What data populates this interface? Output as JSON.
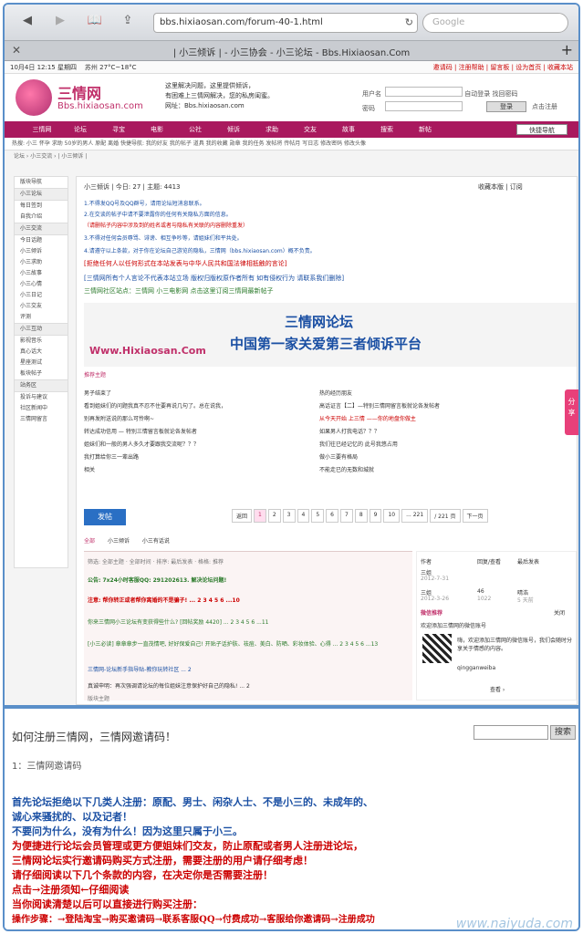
{
  "browser": {
    "url": "bbs.hixiaosan.com/forum-40-1.html",
    "search_placeholder": "Google",
    "tab_title": "| 小三倾诉 | - 小三协会 - 小三论坛 - Bbs.Hixiaosan.Com"
  },
  "topstrip": {
    "date": "10月4日 12:15 星期四",
    "weather": "苏州  27°C~18°C",
    "links": "邀请码 | 注册帮助 | 留言板 | 设为首页 | 收藏本站"
  },
  "header": {
    "logo_text": "三情网",
    "logo_url": "Bbs.hixiaosan.com",
    "slogan_1": "这里解决问题，这里提供倾诉，",
    "slogan_2": "有困难上三情网解决，您的私房闺蜜。",
    "slogan_3": "网址：Bbs.hixiaosan.com",
    "user_label": "用户名",
    "pass_label": "密码",
    "autologin": "自动登录",
    "find_pass": "找回密码",
    "login_btn": "登录",
    "register": "点击注册"
  },
  "mainnav": [
    "三情网",
    "论坛",
    "寻宝",
    "电影",
    "公社",
    "倾诉",
    "求助",
    "交友",
    "故事",
    "搜索",
    "新帖"
  ],
  "quicknav": "快捷导航",
  "subnav": "热搜: 小三  怀孕  求助  50岁的男人  原配  离婚  快捷导航:  我的好友  我的帖子  道具  我的收藏  勋章  我的任务  发帖将  传帖月  写日志  修改密码  修改头像",
  "crumb": "论坛 › 小三交流 › | 小三倾诉 |",
  "sidebar": [
    "版块导航",
    "小三论坛",
    "每日签到",
    "自我介绍",
    "小三交流",
    "今日话题",
    "小三倾诉",
    "小三求助",
    "小三故事",
    "小三心情",
    "小三日记",
    "小三交友",
    "评测",
    "小三互动",
    "影视音乐",
    "真心话大",
    "星座测试",
    "板块帖子",
    "站务区",
    "投诉与建议",
    "社区新闻中",
    "三情网留言"
  ],
  "content": {
    "forum_title": "小三倾诉 | 今日: 27 | 主题: 4413",
    "actions": "收藏本版 | 订阅",
    "rules": [
      "1.不得发QQ号及QQ群号，请用论坛短消息联系。",
      "2.在交谈的帖子中请不要泄露你的任何有关隐私方面的信息。",
      "（请删帖子内容中涉及到的姓名或者与隐私有关联的内容删除重发）",
      "3.不得对任何会员辱骂、诽谤、相互争吵等，请姐妹们和平共处。",
      "4.请遵守以上条款，对于你在论坛自己游览的隐私，三情网（bbs.hixiaosan.com）概不负责。",
      "[拒绝任何人以任何形式在本站发表与中华人民共和国法律相抵触的言论]",
      "[三情网所有个人言论不代表本站立场 版权归版权原作者所有 如有侵权行为 请联系我们删除]",
      "三情网社区站点：三情网  小三电影网  点击这里订阅三情网最新帖子"
    ],
    "banner_title": "三情网论坛",
    "banner_sub": "中国第一家关爱第三者倾诉平台",
    "banner_url": "Www.Hixiaosan.Com",
    "recommend": "推荐主题",
    "left_topics": [
      "男子结束了",
      "看到姐妹们的问题我真不忍不住要再说几句了。总在说我，",
      "别再发附送说的那么可怜啊~",
      "转达成功信用 — 特别三情留言板就论各发帖者",
      "姐妹们和一般的男人多久才要跟我交流呢？？？",
      "我打算给你三一辈出路",
      "相关"
    ],
    "right_topics": [
      "热的经历朋友",
      "高话证言【二】—特别三情网留言板就论各发帖者",
      "从今天开始 上三情 ——你的地盘你做主",
      "如果男人打我电话？？？",
      "我们往已经记忆的 此号我悠占用",
      "做小三要有格局",
      "不能走已的无数和城就"
    ],
    "post_btn": "发帖",
    "pager": [
      "返回",
      "1",
      "2",
      "3",
      "4",
      "5",
      "6",
      "7",
      "8",
      "9",
      "10",
      "... 221",
      "/ 221 页",
      "下一页"
    ],
    "tabs": [
      "全部",
      "小三倾诉",
      "小三有话说"
    ],
    "filter": "筛选: 全部主题 · 全部时间 · 排序: 最后发表 · 格格: 推荐",
    "threads": [
      "公告: 7x24小时客服QQ: 291202613. 解决论坛问题!",
      "注意: 帮你转正或者帮你离婚的不是骗子! ... 2 3 4 5 6 ...10",
      "你来三情网小三论坛有变获得些什么? [回帖奖励 4420] ... 2 3 4 5 6 ...11",
      "[小三必读] 章章章步一直茂情吧, 好好保爱自己! 开贴子话护肤、祛痘、美白、防晒、彩妆体验、心得 ... 2 3 4 5 6 ...13",
      "三情网-论坛新手指导贴-教你玩转社区 ... 2",
      "真诚申明：再次强调请论坛的每位姐妹注意保护好自己的隐私! ... 2",
      "版块主题"
    ],
    "right_col": {
      "author": "作者",
      "replies": "回复/查看",
      "last": "最后发表",
      "row1_a": "三姐",
      "row1_d": "2012-7-31",
      "row2_a": "三姐",
      "row2_d": "2012-3-26",
      "row2_n": "46",
      "row2_m": "1022",
      "row2_l": "晴浩",
      "row2_t": "5 天前",
      "wechat_title": "微信推荐",
      "close": "关闭",
      "wechat_sub": "欢迎添加三情网的微信账号",
      "wechat_text": "嗨，欢迎添加三情网的微信账号，我们会随时分享关于情感的内容。",
      "wechat_id": "qingganweiba",
      "more": "查看 ›"
    }
  },
  "share": "分享",
  "lower": {
    "title": "如何注册三情网，三情网邀请码！",
    "search_btn": "搜索",
    "subtitle": "1：三情网邀请码",
    "lines": [
      "首先论坛拒绝以下几类人注册：原配、男士、闲杂人士、不是小三的、未成年的、",
      "诚心来骚扰的、以及记者！",
      "不要问为什么，没有为什么！因为这里只属于小三。",
      "为便捷进行论坛会员管理或更方便姐妹们交友，防止原配或者男人注册进论坛，",
      "三情网论坛实行邀请码购买方式注册，需要注册的用户请仔细考虑！",
      "请仔细阅读以下几个条款的内容，在决定你是否需要注册！",
      "点击→注册须知←仔细阅读",
      "当你阅读清楚以后可以直接进行购买注册：",
      "操作步骤：→登陆淘宝→购买邀请码→联系客服QQ→付费成功→客服给你邀请码→注册成功"
    ],
    "watermark": "www.naiyuda.com"
  },
  "colors": {
    "brand": "#a9195e",
    "link_blue": "#1a4fa3",
    "red": "#cc0000",
    "green": "#2a7a2a"
  }
}
